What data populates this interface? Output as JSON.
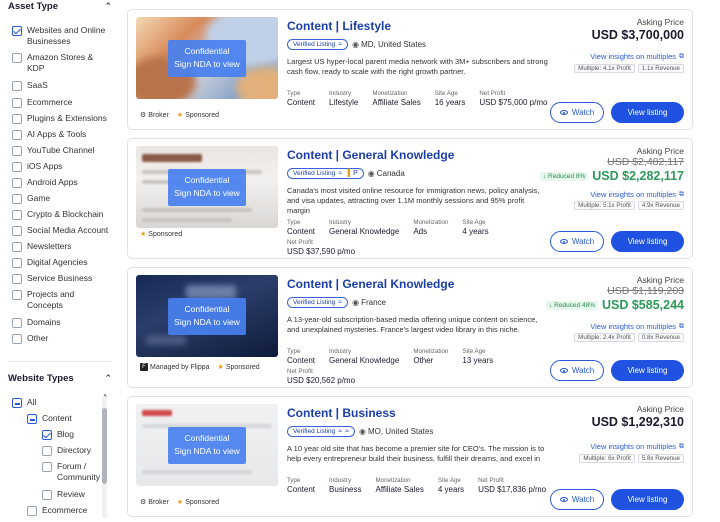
{
  "sidebar": {
    "asset_type": {
      "title": "Asset Type",
      "items": [
        {
          "label": "Websites and Online Businesses",
          "checked": true
        },
        {
          "label": "Amazon Stores & KDP",
          "checked": false
        },
        {
          "label": "SaaS",
          "checked": false
        },
        {
          "label": "Ecommerce",
          "checked": false
        },
        {
          "label": "Plugins & Extensions",
          "checked": false
        },
        {
          "label": "AI Apps & Tools",
          "checked": false
        },
        {
          "label": "YouTube Channel",
          "checked": false
        },
        {
          "label": "iOS Apps",
          "checked": false
        },
        {
          "label": "Android Apps",
          "checked": false
        },
        {
          "label": "Game",
          "checked": false
        },
        {
          "label": "Crypto & Blockchain",
          "checked": false
        },
        {
          "label": "Social Media Account",
          "checked": false
        },
        {
          "label": "Newsletters",
          "checked": false
        },
        {
          "label": "Digital Agencies",
          "checked": false
        },
        {
          "label": "Service Business",
          "checked": false
        },
        {
          "label": "Projects and Concepts",
          "checked": false
        },
        {
          "label": "Domains",
          "checked": false
        },
        {
          "label": "Other",
          "checked": false
        }
      ]
    },
    "website_types": {
      "title": "Website Types",
      "items": [
        {
          "label": "All",
          "state": "minus",
          "level": 0
        },
        {
          "label": "Content",
          "state": "minus",
          "level": 1
        },
        {
          "label": "Blog",
          "state": "checked",
          "level": 2
        },
        {
          "label": "Directory",
          "state": "none",
          "level": 2
        },
        {
          "label": "Forum / Community",
          "state": "none",
          "level": 2
        },
        {
          "label": "Review",
          "state": "none",
          "level": 2
        },
        {
          "label": "Ecommerce",
          "state": "none",
          "level": 1
        }
      ]
    }
  },
  "common": {
    "asking_label": "Asking Price",
    "insights_label": "View insights on multiples",
    "watch_label": "Watch",
    "view_label": "View listing",
    "verified_label": "Verified Listing",
    "nda_line1": "Confidential",
    "nda_line2": "Sign NDA to view",
    "type_label": "Type",
    "industry_label": "Industry",
    "monetization_label": "Monetization",
    "site_age_label": "Site Age",
    "net_profit_label": "Net Profit",
    "multiple_label": "Multiple:",
    "broker_label": "Broker",
    "sponsored_label": "Sponsored",
    "managed_label": "Managed by Flippa"
  },
  "listings": [
    {
      "title": "Content | Lifestyle",
      "location": "MD, United States",
      "description": "Largest US hyper-local parent media network with 3M+ subscribers and strong cash flow, ready to scale with the right growth partner.",
      "type": "Content",
      "industry": "Lifestyle",
      "monetization": "Affiliate Sales",
      "site_age": "16 years",
      "net_profit": "USD $75,000 p/mo",
      "price": "USD $3,700,000",
      "profit_multiple": "4.1x Profit",
      "revenue_multiple": "1.1x Revenue"
    },
    {
      "title": "Content | General Knowledge",
      "location": "Canada",
      "description": "Canada's most visited online resource for immigration news, policy analysis, and visa updates, attracting over 1.1M monthly sessions and 95% profit margin",
      "type": "Content",
      "industry": "General Knowledge",
      "monetization": "Ads",
      "site_age": "4 years",
      "net_profit": "USD $37,590 p/mo",
      "old_price": "USD $2,482,117",
      "reduced": "Reduced 8%",
      "price": "USD $2,282,117",
      "profit_multiple": "5.1x Profit",
      "revenue_multiple": "4.9x Revenue"
    },
    {
      "title": "Content | General Knowledge",
      "location": "France",
      "description": "A 13-year-old subscription-based media offering unique content on science, and unexplained mysteries. France's largest video library in this niche.",
      "type": "Content",
      "industry": "General Knowledge",
      "monetization": "Other",
      "site_age": "13 years",
      "net_profit": "USD $20,562 p/mo",
      "old_price": "USD $1,119,203",
      "reduced": "Reduced 48%",
      "price": "USD $585,244",
      "profit_multiple": "2.4x Profit",
      "revenue_multiple": "0.8x Revenue"
    },
    {
      "title": "Content | Business",
      "location": "MO, United States",
      "description": "A 10 year old site that has become a premier site for CEO's. The mission is to help every entrepreneur build their business, fulfill their dreams, and excel in",
      "type": "Content",
      "industry": "Business",
      "monetization": "Affiliate Sales",
      "site_age": "4 years",
      "net_profit": "USD $17,836 p/mo",
      "price": "USD $1,292,310",
      "profit_multiple": "6x Profit",
      "revenue_multiple": "5.8x Revenue"
    }
  ]
}
